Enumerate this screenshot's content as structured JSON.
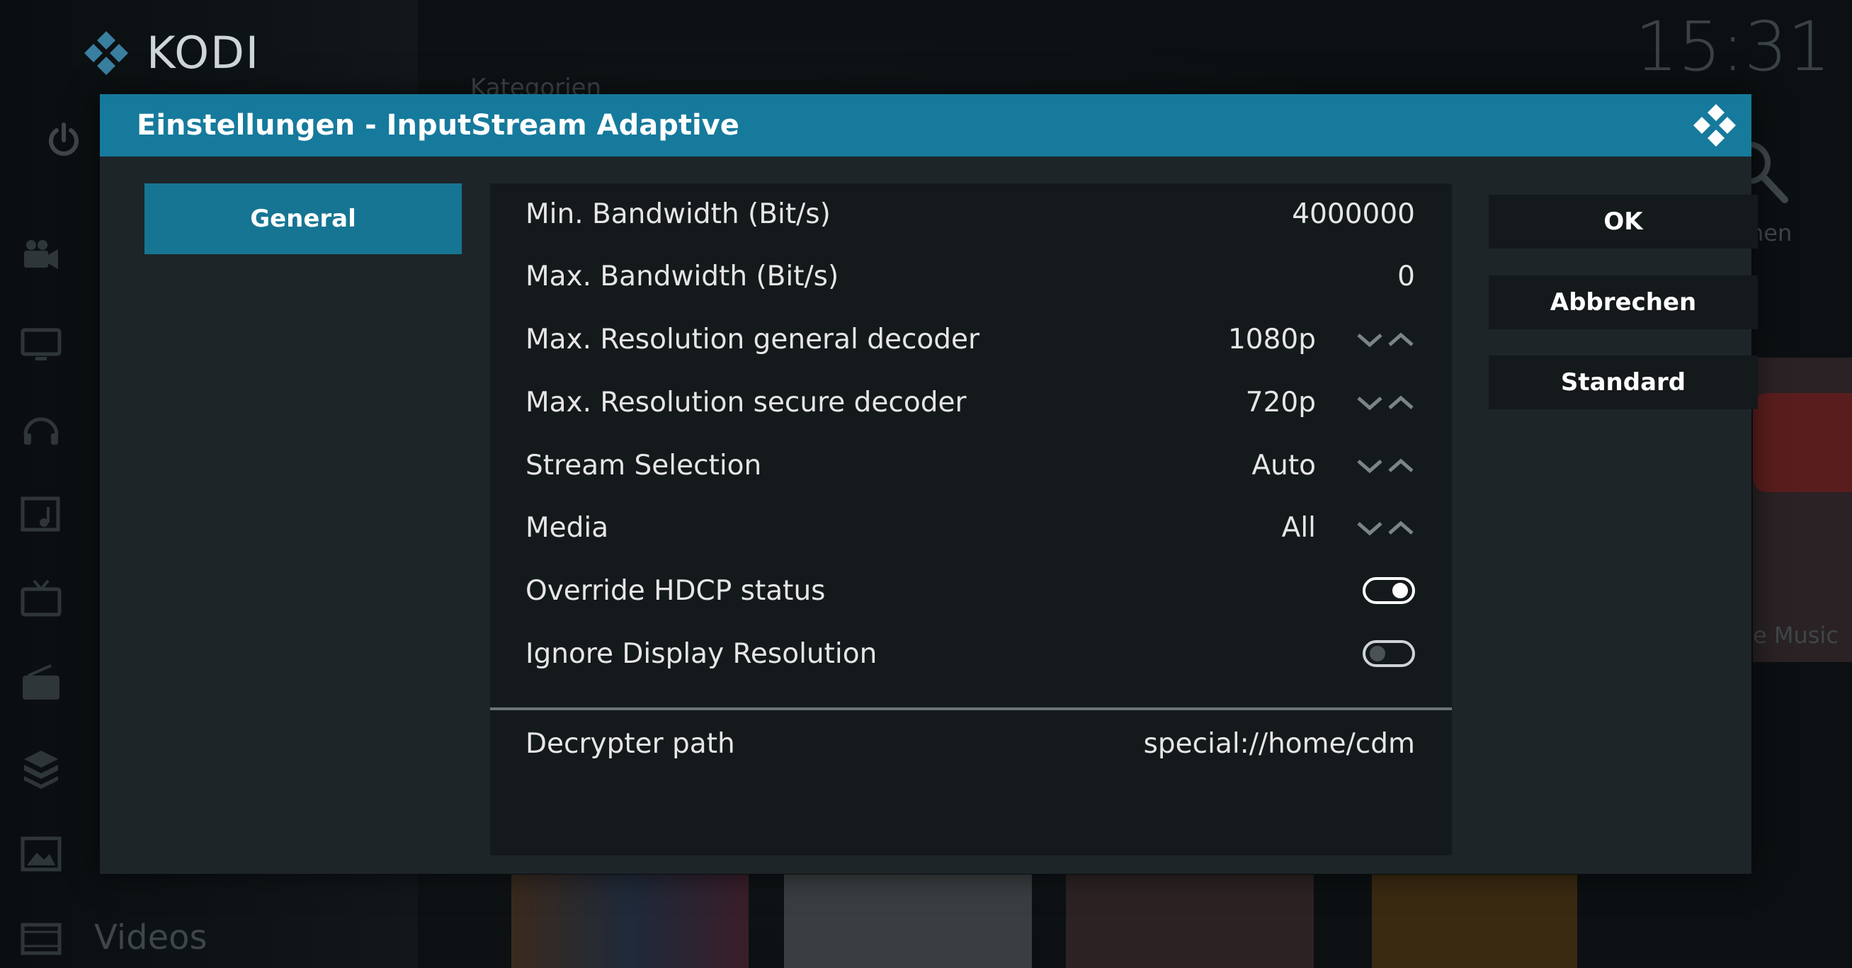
{
  "background": {
    "app_name": "KODI",
    "clock": "15:31",
    "categories_heading": "Kategorien",
    "bottom_nav_label": "Videos",
    "search_label_partial": "hen",
    "music_label_partial": "e Music",
    "tile_text_primemusic": "Prime music"
  },
  "dialog": {
    "title": "Einstellungen - InputStream Adaptive",
    "categories": [
      {
        "label": "General",
        "selected": true
      }
    ],
    "settings": [
      {
        "label": "Min. Bandwidth (Bit/s)",
        "value": "4000000",
        "control": "text"
      },
      {
        "label": "Max. Bandwidth (Bit/s)",
        "value": "0",
        "control": "text"
      },
      {
        "label": "Max. Resolution general decoder",
        "value": "1080p",
        "control": "spinner"
      },
      {
        "label": "Max. Resolution secure decoder",
        "value": "720p",
        "control": "spinner"
      },
      {
        "label": "Stream Selection",
        "value": "Auto",
        "control": "spinner"
      },
      {
        "label": "Media",
        "value": "All",
        "control": "spinner"
      },
      {
        "label": "Override HDCP status",
        "value": true,
        "control": "toggle"
      },
      {
        "label": "Ignore Display Resolution",
        "value": false,
        "control": "toggle"
      },
      {
        "label": "Decrypter path",
        "value": "special://home/cdm",
        "control": "text"
      }
    ],
    "buttons": {
      "ok": "OK",
      "cancel": "Abbrechen",
      "default": "Standard"
    }
  },
  "colors": {
    "header": "#167a9c",
    "selected_category": "#167593",
    "dialog_bg": "#1e2529",
    "panel_bg": "#14191c"
  }
}
